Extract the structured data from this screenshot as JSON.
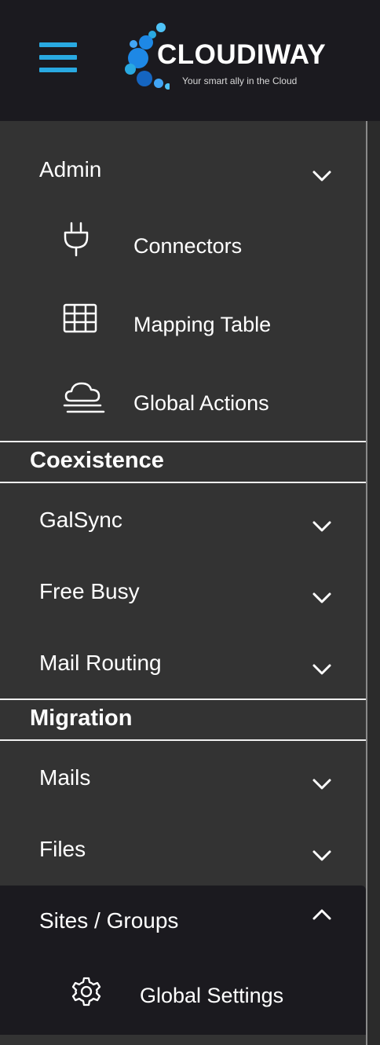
{
  "header": {
    "menu_icon": "hamburger-menu-icon",
    "logo": {
      "name": "CLOUDIWAY",
      "tagline": "Your smart ally in the Cloud"
    },
    "colors": {
      "accent": "#29a9e1",
      "header_bg": "#1b1a1f",
      "sidebar_bg": "#333333"
    }
  },
  "admin": {
    "label": "Admin",
    "chevron": "chevron-down-icon",
    "items": [
      {
        "label": "Connectors",
        "icon": "plug-icon"
      },
      {
        "label": "Mapping Table",
        "icon": "table-grid-icon"
      },
      {
        "label": "Global Actions",
        "icon": "cloud-fog-icon"
      }
    ]
  },
  "coexistence": {
    "title": "Coexistence",
    "items": [
      {
        "label": "GalSync"
      },
      {
        "label": "Free Busy"
      },
      {
        "label": "Mail Routing"
      }
    ]
  },
  "migration": {
    "title": "Migration",
    "items": [
      {
        "label": "Mails"
      },
      {
        "label": "Files"
      },
      {
        "label": "Sites / Groups",
        "expanded": true
      }
    ],
    "sites_groups_children": [
      {
        "label": "Global Settings",
        "icon": "gear-icon"
      }
    ]
  }
}
